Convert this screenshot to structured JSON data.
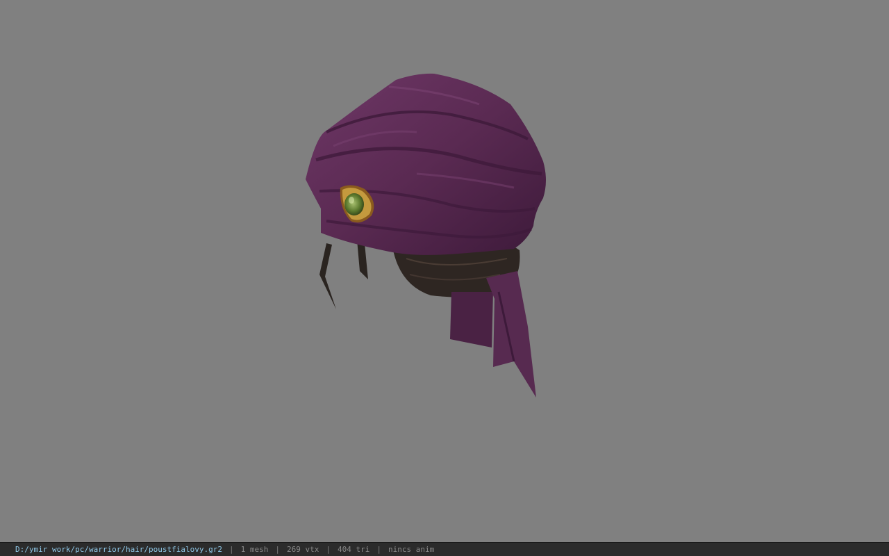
{
  "viewer": {
    "background_color": "#808080",
    "model_name": "purple-turban-hair-model"
  },
  "status_bar": {
    "file_path": "D:/ymir work/pc/warrior/hair/poustfialovy.gr2",
    "separator": "|",
    "mesh_count": "1 mesh",
    "vertex_count": "269 vtx",
    "triangle_count": "404 tri",
    "anim_status": "nincs anim"
  },
  "colors": {
    "turban_main": "#5a2a52",
    "turban_dark": "#3d1a3a",
    "turban_light": "#6e3766",
    "hair_dark": "#2e2622",
    "jewel_green": "#6a8a3a",
    "jewel_gold": "#b8862e",
    "status_bg": "#2b2b2b",
    "path_text": "#8fc8e8"
  }
}
